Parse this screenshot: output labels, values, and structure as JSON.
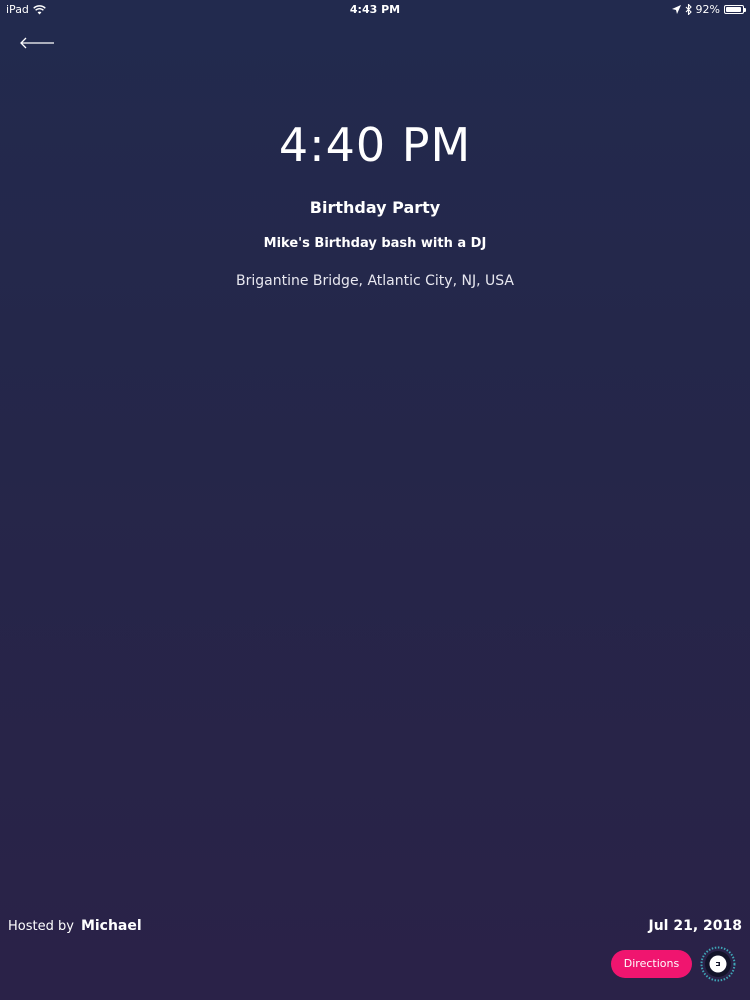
{
  "status_bar": {
    "device": "iPad",
    "time": "4:43 PM",
    "battery": "92%",
    "battery_level": 0.92
  },
  "event": {
    "time": "4:40 PM",
    "title": "Birthday Party",
    "description": "Mike's Birthday bash with a DJ",
    "location": "Brigantine Bridge, Atlantic City, NJ, USA",
    "hosted_by_label": "Hosted by",
    "host": "Michael",
    "date": "Jul 21, 2018"
  },
  "actions": {
    "directions_label": "Directions"
  },
  "icons": {
    "back": "back-arrow-icon",
    "ride": "uber-icon",
    "wifi": "wifi-icon",
    "location": "location-arrow-icon",
    "bluetooth": "bluetooth-icon",
    "battery": "battery-icon"
  },
  "colors": {
    "accent": "#f0156f",
    "background_top": "#222a4e",
    "background_bottom": "#2a2248"
  }
}
